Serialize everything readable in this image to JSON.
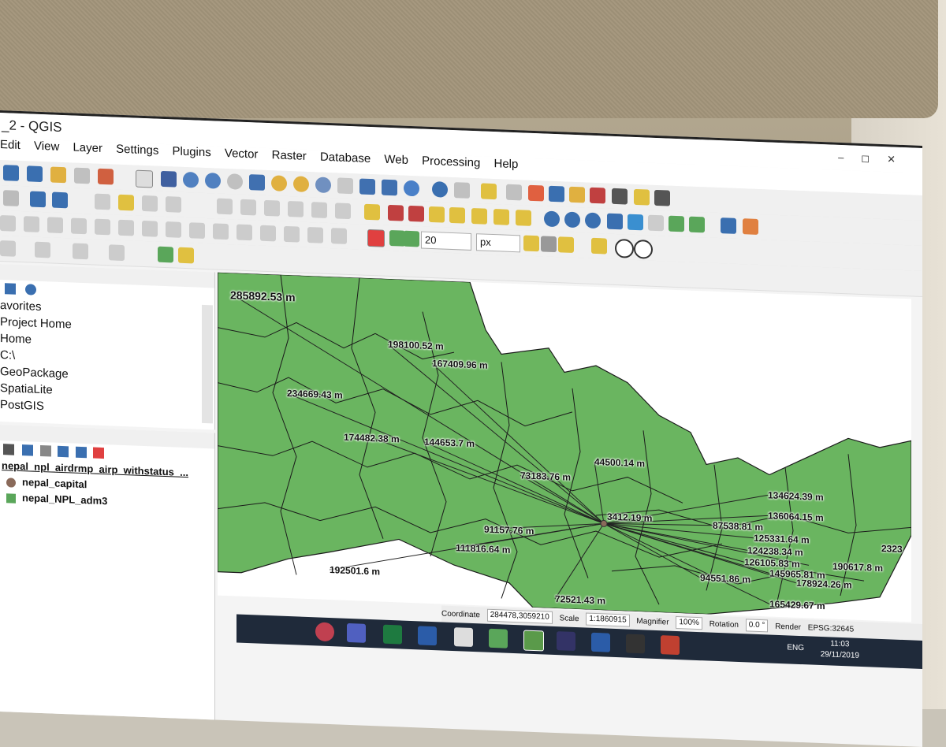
{
  "window": {
    "title": "_2 - QGIS"
  },
  "menu": [
    "Edit",
    "View",
    "Layer",
    "Settings",
    "Plugins",
    "Vector",
    "Raster",
    "Database",
    "Web",
    "Processing",
    "Help"
  ],
  "snapping": {
    "tolerance": "20",
    "unit": "px"
  },
  "browser": {
    "items": [
      "avorites",
      "Project Home",
      "Home",
      "C:\\",
      "GeoPackage",
      "SpatiaLite",
      "PostGIS"
    ]
  },
  "layers": {
    "items": [
      {
        "label": "nepal_npl_airdrmp_airp_withstatus_...",
        "swatch": "#ffffff"
      },
      {
        "label": "nepal_capital",
        "swatch": "#8a6a5a"
      },
      {
        "label": "nepal_NPL_adm3",
        "swatch": "#5aa65a"
      }
    ]
  },
  "map": {
    "fill_color": "#6ab560",
    "labels": [
      "285892.53 m",
      "198100.52 m",
      "167409.96 m",
      "234669.43 m",
      "174482.38 m",
      "144653.7 m",
      "73183.76 m",
      "44500.14 m",
      "3412.19 m",
      "91157.76 m",
      "111816.64 m",
      "192501.6 m",
      "72521.43 m",
      "134624.39 m",
      "136064.15 m",
      "87538.81 m",
      "125331.64 m",
      "124238.34 m",
      "126105.83 m",
      "145965.81 m",
      "190617.8 m",
      "178924.26 m",
      "94551.86 m",
      "165429.67 m",
      "2323"
    ]
  },
  "statusbar": {
    "coordinate_label": "Coordinate",
    "coordinate": "284478,3059210",
    "scale_label": "Scale",
    "scale": "1:1860915",
    "magnifier_label": "Magnifier",
    "magnifier": "100%",
    "rotation_label": "Rotation",
    "rotation": "0.0 °",
    "render": "Render",
    "crs": "EPSG:32645"
  },
  "system": {
    "lang": "ENG",
    "time": "11:03",
    "date": "29/11/2019"
  }
}
